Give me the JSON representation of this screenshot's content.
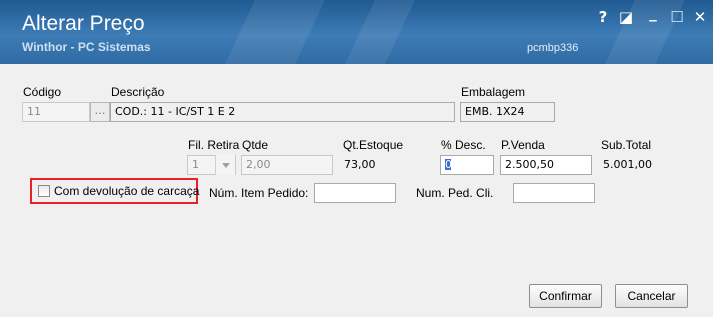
{
  "window": {
    "title": "Alterar Preço",
    "subtitle": "Winthor - PC Sistemas",
    "code": "pcmbp336",
    "controls": {
      "help": "?",
      "restore": "◪",
      "minimize": "_",
      "maximize": "☐",
      "close": "✕"
    }
  },
  "form": {
    "codigo": {
      "label": "Código",
      "value": "11"
    },
    "descricao": {
      "label": "Descrição",
      "value": "COD.: 11 - IC/ST 1 E 2"
    },
    "embalagem": {
      "label": "Embalagem",
      "value": "EMB. 1X24"
    },
    "fil_retira": {
      "label": "Fil. Retira",
      "value": "1"
    },
    "qtde": {
      "label": "Qtde",
      "value": "2,00"
    },
    "qt_estoque": {
      "label": "Qt.Estoque",
      "value": "73,00"
    },
    "desc": {
      "label": "% Desc.",
      "value": "0"
    },
    "p_venda": {
      "label": "P.Venda",
      "value": "2.500,50"
    },
    "sub_total": {
      "label": "Sub.Total",
      "value": "5.001,00"
    },
    "devolucao": {
      "label": "Com devolução de carcaça",
      "checked": false
    },
    "num_item_pedido": {
      "label": "Núm. Item Pedido:",
      "value": ""
    },
    "num_ped_cli": {
      "label": "Num. Ped. Cli.",
      "value": ""
    }
  },
  "buttons": {
    "confirmar": "Confirmar",
    "cancelar": "Cancelar"
  },
  "colors": {
    "titlebar": "#2f6aa3",
    "highlight": "#e8222b"
  }
}
